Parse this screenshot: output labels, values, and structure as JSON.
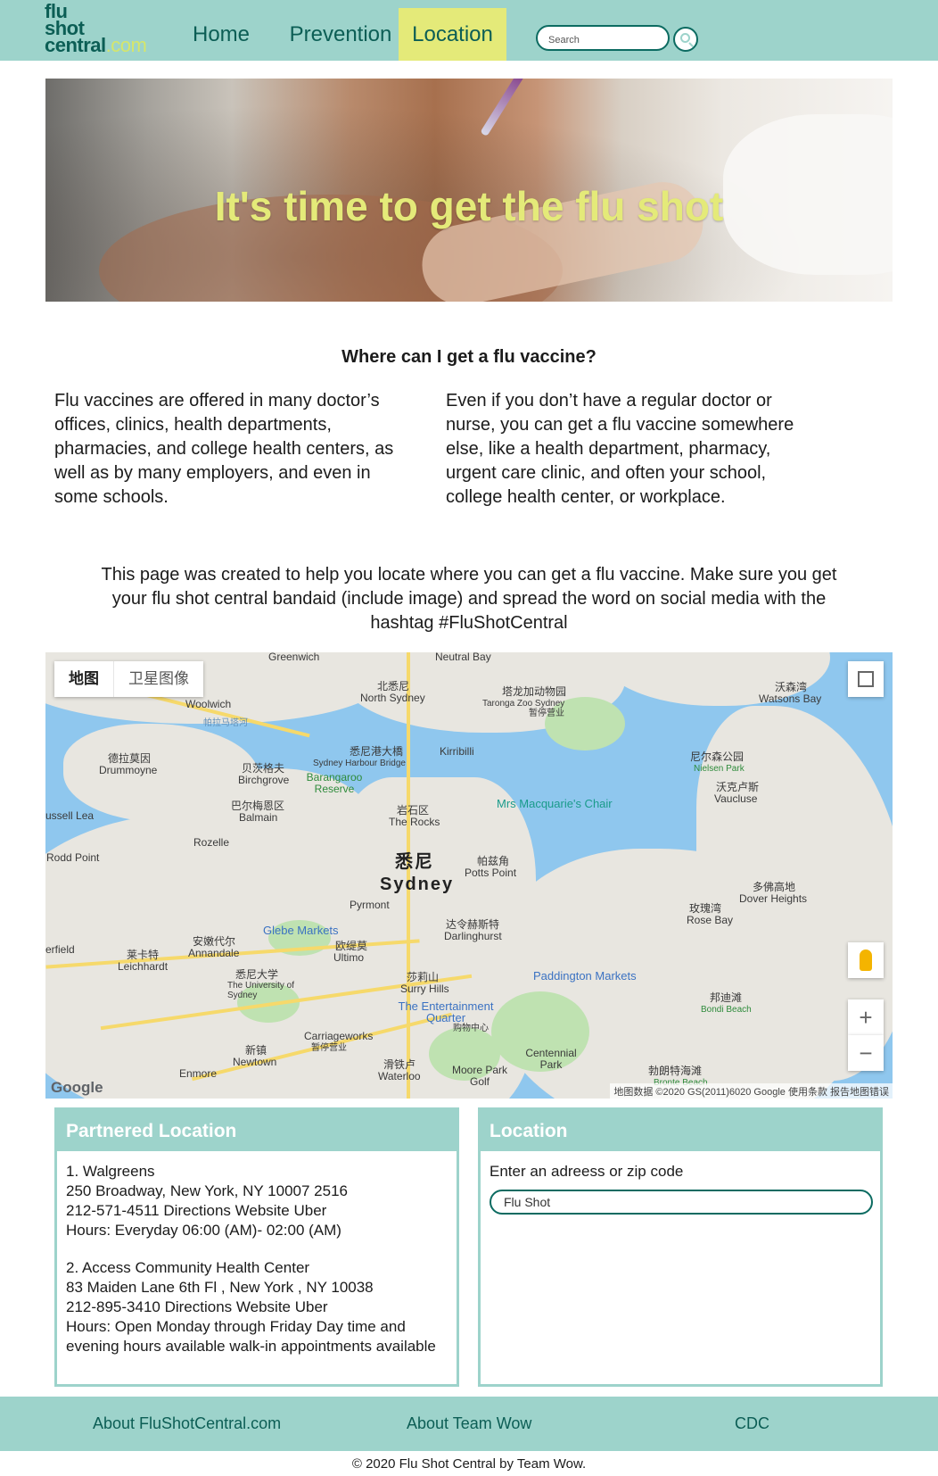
{
  "site": {
    "logo_line1": "flu",
    "logo_line2": "shot",
    "logo_line3": "central",
    "logo_suffix": ".com"
  },
  "nav": {
    "items": [
      {
        "label": "Home",
        "active": false
      },
      {
        "label": "Prevention",
        "active": false
      },
      {
        "label": "Location",
        "active": true
      }
    ],
    "search_placeholder": "Search"
  },
  "hero": {
    "title": "It's time to get the flu shot"
  },
  "intro": {
    "heading": "Where can I get a flu vaccine?",
    "left_text": "Flu vaccines are offered in many doctor’s offices, clinics, health departments, pharmacies, and college health centers, as well as by many employers, and even in some schools.",
    "right_text": "Even if you don’t have a regular doctor or nurse, you can get a flu vaccine somewhere else, like a health department, pharmacy, urgent care clinic, and often your school, college health center, or workplace.",
    "tagline": "This page was created to help you locate where you can get a flu vaccine. Make sure you get your flu shot central bandaid (include image) and spread the word on social media with the hashtag #FluShotCentral"
  },
  "map": {
    "tab_map": "地图",
    "tab_satellite": "卫星图像",
    "zoom_in": "+",
    "zoom_out": "−",
    "google": "Google",
    "attribution": "地图数据 ©2020 GS(2011)6020 Google   使用条款   报告地图错误",
    "labels": {
      "greenwich": "Greenwich",
      "neutral_bay": "Neutral Bay",
      "north_sydney_cn": "北悉尼",
      "north_sydney": "North Sydney",
      "taronga_cn": "塔龙加动物园",
      "taronga": "Taronga Zoo Sydney",
      "taronga_status": "暂停营业",
      "watsons_cn": "沃森湾",
      "watsons": "Watsons Bay",
      "woolwich": "Woolwich",
      "parramatta_river": "帕拉马塔河",
      "drummoyne_cn": "德拉莫因",
      "drummoyne": "Drummoyne",
      "birchgrove_cn": "贝茨格夫",
      "birchgrove": "Birchgrove",
      "harbour_bridge_cn": "悉尼港大橋",
      "harbour_bridge": "Sydney Harbour Bridge",
      "kirribilli": "Kirribilli",
      "barangaroo": "Barangaroo Reserve",
      "nielsen_cn": "尼尔森公园",
      "nielsen": "Nielsen Park",
      "vaucluse_cn": "沃克卢斯",
      "vaucluse": "Vaucluse",
      "balmain_cn": "巴尔梅恩区",
      "balmain": "Balmain",
      "rocks_cn": "岩石区",
      "rocks": "The Rocks",
      "macquarie": "Mrs Macquarie's Chair",
      "russell_lea": "ussell Lea",
      "rozelle": "Rozelle",
      "rodd_point": "Rodd Point",
      "sydney_cn": "悉尼",
      "sydney": "Sydney",
      "potts_cn": "帕兹角",
      "potts": "Potts Point",
      "dover_cn": "多佛高地",
      "dover": "Dover Heights",
      "pyrmont": "Pyrmont",
      "darlinghurst_cn": "达令赫斯特",
      "darlinghurst": "Darlinghurst",
      "rose_bay_cn": "玫瑰湾",
      "rose_bay": "Rose Bay",
      "glebe": "Glebe Markets",
      "annandale_cn": "安嫩代尔",
      "annandale": "Annandale",
      "leichhardt_cn": "莱卡特",
      "leichhardt": "Leichhardt",
      "ultimo_cn": "欧缇莫",
      "ultimo": "Ultimo",
      "surry_cn": "莎莉山",
      "surry": "Surry Hills",
      "paddington": "Paddington Markets",
      "uni_cn": "悉尼大学",
      "uni": "The University of Sydney",
      "bondi_cn": "邦迪滩",
      "bondi": "Bondi Beach",
      "erfield": "erfield",
      "entertainment": "The Entertainment Quarter",
      "entertainment_cn": "购物中心",
      "carriageworks": "Carriageworks",
      "carriageworks_status": "暂停营业",
      "newtown_cn": "新镇",
      "newtown": "Newtown",
      "centennial": "Centennial Park",
      "enmore": "Enmore",
      "waterloo_cn": "滑铁卢",
      "waterloo": "Waterloo",
      "moore": "Moore Park Golf",
      "bronte_cn": "勃朗特海滩",
      "bronte": "Bronte Beach"
    }
  },
  "partnered": {
    "heading": "Partnered Location",
    "locations": [
      {
        "name": "1. Walgreens",
        "address": "250 Broadway, New York, NY 10007 2516",
        "contact": "212-571-4511 Directions Website Uber",
        "hours": "Hours: Everyday 06:00 (AM)- 02:00 (AM)"
      },
      {
        "name": "2. Access Community Health Center",
        "address": "83 Maiden Lane 6th Fl , New York , NY 10038",
        "contact": "212-895-3410 Directions Website Uber",
        "hours": "Hours: Open Monday through Friday Day time and evening hours available walk-in appointments available"
      }
    ]
  },
  "location_panel": {
    "heading": "Location",
    "label": "Enter an adreess or zip code",
    "input_value": "Flu Shot"
  },
  "footer": {
    "about_site": "About FluShotCentral.com",
    "about_team": "About Team Wow",
    "cdc": "CDC",
    "copyright": "© 2020 Flu Shot Central by Team Wow."
  },
  "colors": {
    "header_teal": "#9dd3cb",
    "active_yellow": "#e4ea79",
    "dark_teal": "#0c5e55",
    "hero_title_yellow": "#e4ea79"
  }
}
